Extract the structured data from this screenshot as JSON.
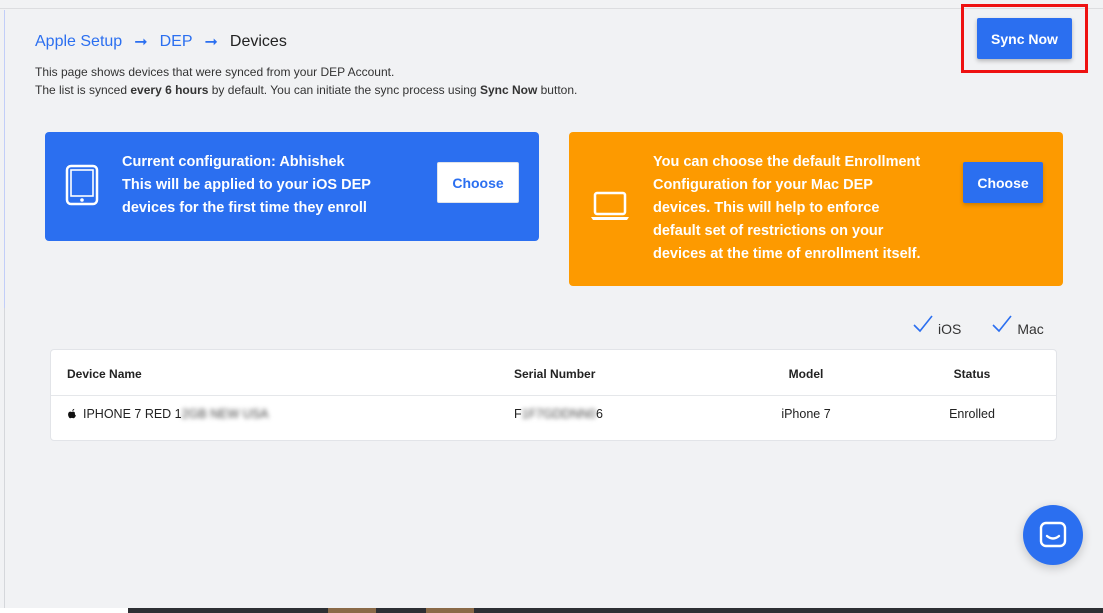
{
  "breadcrumb": {
    "items": [
      "Apple Setup",
      "DEP"
    ],
    "current": "Devices",
    "separator": "➞"
  },
  "description": {
    "line1": "This page shows devices that were synced from your DEP Account.",
    "line2_prefix": "The list is synced ",
    "line2_bold": "every 6 hours",
    "line2_mid": " by default. You can initiate the sync process using ",
    "line2_bold2": "Sync Now",
    "line2_suffix": " button."
  },
  "sync_button": {
    "label": "Sync Now"
  },
  "ios_card": {
    "line1": "Current configuration: Abhishek",
    "line2": "This will be applied to your iOS DEP",
    "line3": "devices for the first time they enroll",
    "button": "Choose",
    "icon": "tablet-icon"
  },
  "mac_card": {
    "line1": "You can choose the default Enrollment",
    "line2": "Configuration for your Mac DEP",
    "line3": "devices. This will help to enforce",
    "line4": "default set of restrictions on your",
    "line5": "devices at the time of enrollment itself.",
    "button": "Choose",
    "icon": "laptop-icon"
  },
  "filters": [
    {
      "label": "iOS",
      "checked": true
    },
    {
      "label": "Mac",
      "checked": true
    }
  ],
  "table": {
    "headers": [
      "Device Name",
      "Serial Number",
      "Model",
      "Status"
    ],
    "rows": [
      {
        "name_visible": "IPHONE 7 RED 1",
        "name_blurred": "2GB NEW USA",
        "serial_prefix": "F",
        "serial_blurred": "1F7GDDNN0",
        "serial_suffix": "6",
        "model": "iPhone 7",
        "status": "Enrolled"
      }
    ]
  },
  "colors": {
    "primary": "#2b6ff0",
    "orange": "#fd9a00",
    "highlight": "#ee1111",
    "background": "#f1f2f4"
  }
}
